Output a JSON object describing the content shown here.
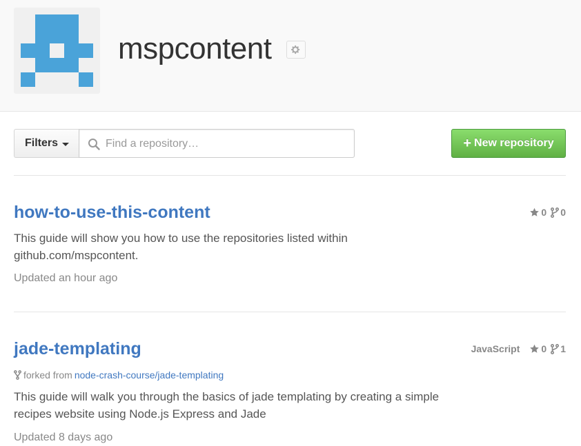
{
  "org": {
    "name": "mspcontent",
    "avatar_color": "#4aa3d9"
  },
  "toolbar": {
    "filters_label": "Filters",
    "search_placeholder": "Find a repository…",
    "search_value": "",
    "new_repo_label": "New repository",
    "new_repo_icon": "plus-icon"
  },
  "repos": [
    {
      "name": "how-to-use-this-content",
      "language": "",
      "stars": "0",
      "forks": "0",
      "description_lines": [
        "This guide will show you how to use the repositories listed within",
        "github.com/mspcontent."
      ],
      "updated": "Updated an hour ago"
    },
    {
      "name": "jade-templating",
      "language": "JavaScript",
      "stars": "0",
      "forks": "1",
      "forked_from_label": "forked from",
      "forked_from": "node-crash-course/jade-templating",
      "description_lines": [
        "This guide will walk you through the basics of jade templating by creating a simple",
        "recipes website using Node.js Express and Jade"
      ],
      "updated": "Updated 8 days ago"
    }
  ],
  "colors": {
    "link": "#4078c0",
    "accent_green": "#6cc644",
    "muted": "#888888"
  }
}
